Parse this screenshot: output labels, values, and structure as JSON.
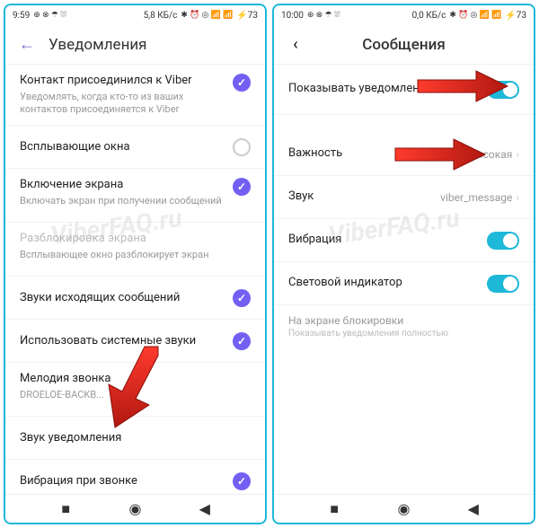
{
  "left": {
    "status": {
      "time": "9:59",
      "data": "5,8 КБ/с",
      "battery": "73"
    },
    "title": "Уведомления",
    "rows": [
      {
        "title": "Контакт присоединился к Viber",
        "sub": "Уведомлять, когда кто-то из ваших контактов присоединяется к Viber",
        "ctrl": "check"
      },
      {
        "title": "Всплывающие окна",
        "ctrl": "empty"
      },
      {
        "title": "Включение экрана",
        "sub": "Включать экран при получении сообщений",
        "ctrl": "check"
      },
      {
        "title": "Разблокировка экрана",
        "sub": "Всплывающее окно разблокирует экран",
        "dim": true
      },
      {
        "title": "Звуки исходящих сообщений",
        "ctrl": "check"
      },
      {
        "title": "Использовать системные звуки",
        "ctrl": "check"
      },
      {
        "title": "Мелодия звонка",
        "sub": "DROELOE-BACKB..."
      },
      {
        "title": "Звук уведомления"
      },
      {
        "title": "Вибрация при звонке",
        "ctrl": "check"
      }
    ]
  },
  "right": {
    "status": {
      "time": "10:00",
      "data": "0,0 КБ/с",
      "battery": "73"
    },
    "title": "Сообщения",
    "rows": [
      {
        "title": "Показывать уведомления",
        "ctrl": "toggle"
      },
      {
        "title": "Важность",
        "value": "Высокая",
        "ctrl": "nav"
      },
      {
        "title": "Звук",
        "value": "viber_message",
        "ctrl": "nav"
      },
      {
        "title": "Вибрация",
        "ctrl": "toggle"
      },
      {
        "title": "Световой индикатор",
        "ctrl": "toggle"
      }
    ],
    "note": {
      "t": "На экране блокировки",
      "s": "Показывать уведомления полностью"
    }
  },
  "watermark": "ViberFAQ.ru"
}
